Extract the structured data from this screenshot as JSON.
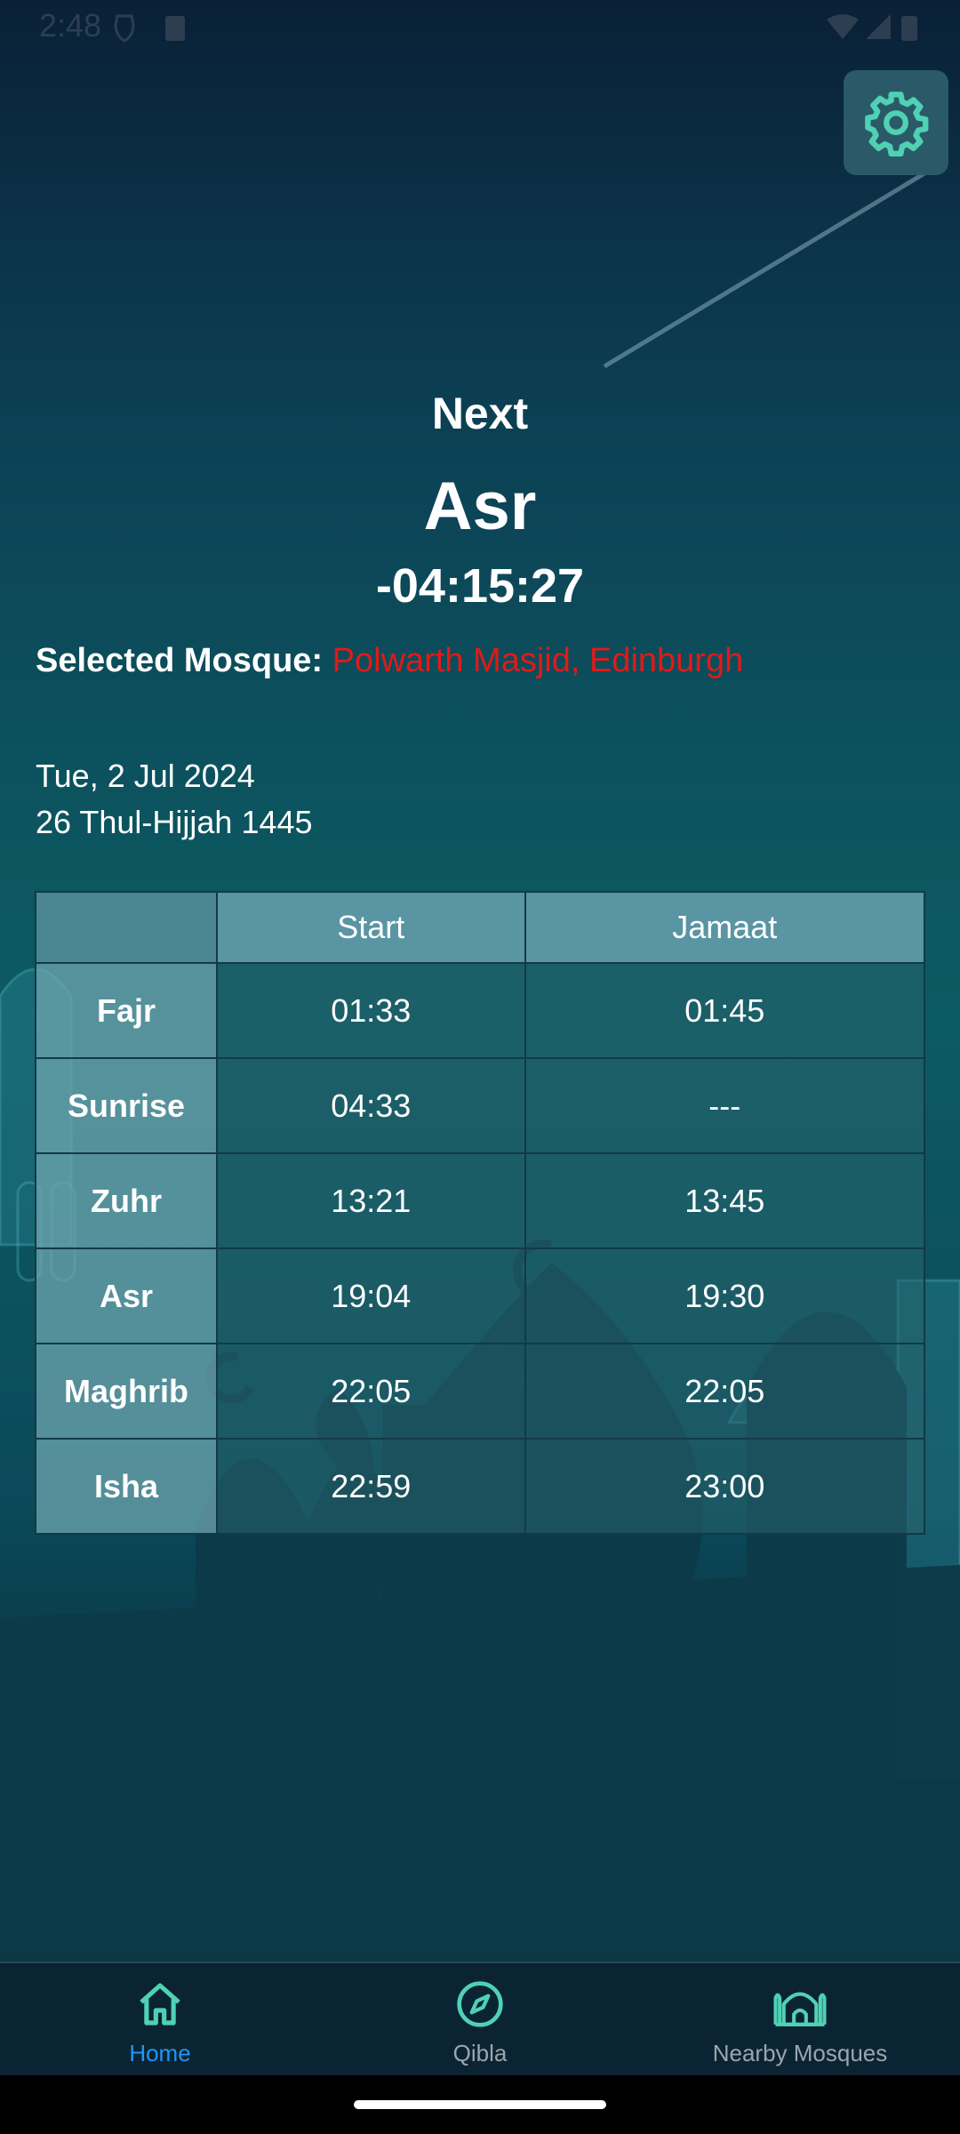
{
  "status_bar": {
    "time": "2:48"
  },
  "header": {
    "settings_icon": "gear-icon"
  },
  "next_prayer": {
    "label": "Next",
    "name": "Asr",
    "countdown": "-04:15:27"
  },
  "mosque": {
    "label": "Selected Mosque:",
    "name": "Polwarth Masjid, Edinburgh",
    "name_color": "#e01a1a"
  },
  "date": {
    "gregorian": "Tue, 2 Jul 2024",
    "hijri": "26 Thul-Hijjah 1445"
  },
  "prayer_table": {
    "headers": [
      "",
      "Start",
      "Jamaat"
    ],
    "rows": [
      {
        "name": "Fajr",
        "start": "01:33",
        "jamaat": "01:45"
      },
      {
        "name": "Sunrise",
        "start": "04:33",
        "jamaat": "---"
      },
      {
        "name": "Zuhr",
        "start": "13:21",
        "jamaat": "13:45"
      },
      {
        "name": "Asr",
        "start": "19:04",
        "jamaat": "19:30"
      },
      {
        "name": "Maghrib",
        "start": "22:05",
        "jamaat": "22:05"
      },
      {
        "name": "Isha",
        "start": "22:59",
        "jamaat": "23:00"
      }
    ]
  },
  "bottom_nav": {
    "items": [
      {
        "label": "Home",
        "icon": "home-icon",
        "active": true
      },
      {
        "label": "Qibla",
        "icon": "compass-icon",
        "active": false
      },
      {
        "label": "Nearby Mosques",
        "icon": "mosque-icon",
        "active": false
      }
    ]
  },
  "colors": {
    "accent_active": "#2196f3",
    "icon_teal": "#4fd1b5",
    "mosque_name": "#e01a1a"
  }
}
